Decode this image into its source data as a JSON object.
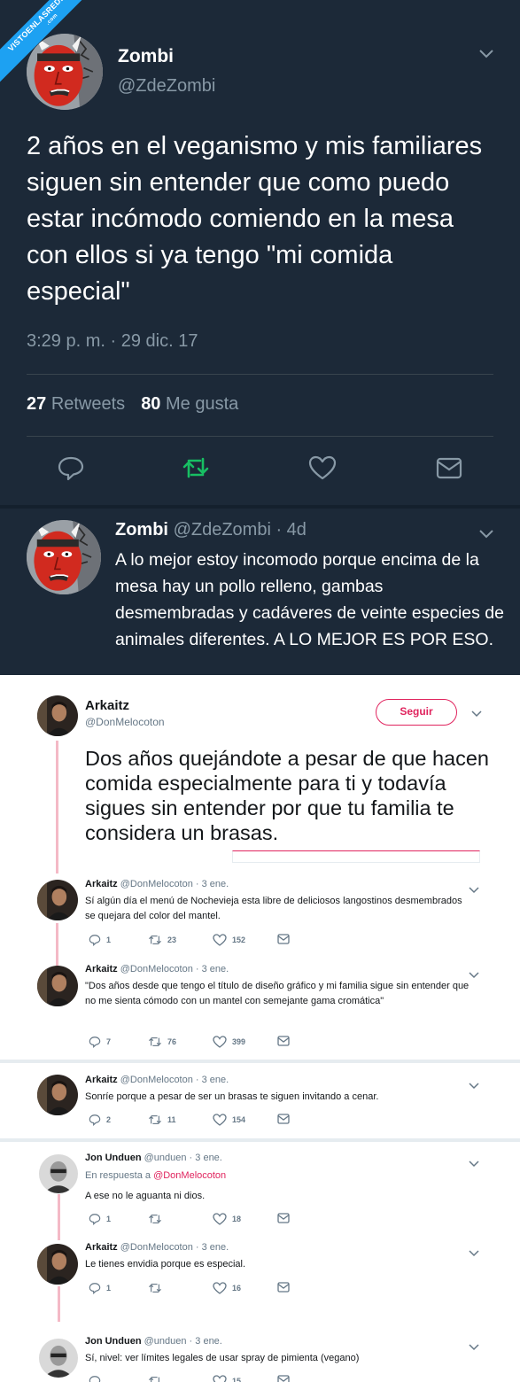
{
  "watermark": {
    "text": "VISTOENLASREDES",
    "sub": ".com"
  },
  "main_tweet": {
    "name": "Zombi",
    "handle": "@ZdeZombi",
    "text": "2 años en el veganismo y mis familiares siguen sin entender que como puedo estar incómodo comiendo en la mesa con ellos si ya tengo \"mi comida especial\"",
    "time": "3:29 p. m. · 29 dic. 17",
    "retweets_count": "27",
    "retweets_label": "Retweets",
    "likes_count": "80",
    "likes_label": "Me gusta",
    "accent_color": "#17bf63"
  },
  "thread_tweet": {
    "name": "Zombi",
    "handle_time": "@ZdeZombi · 4d",
    "text": "A lo mejor estoy incomodo porque encima de la mesa hay un pollo relleno, gambas desmembradas y cadáveres de veinte especies de animales diferentes. A LO MEJOR ES POR ESO."
  },
  "quoted_tweet": {
    "name": "Arkaitz",
    "handle": "@DonMelocoton",
    "follow_label": "Seguir",
    "text": "Dos años quejándote a pesar de que hacen comida especialmente para ti y todavía sigues sin entender por que tu familia te considera un brasas.",
    "accent_color": "#e0245e"
  },
  "replies": [
    {
      "name": "Arkaitz",
      "meta": "@DonMelocoton · 3 ene.",
      "text": "Sí algún día el menú de Nochevieja esta libre de deliciosos langostinos desmembrados se quejara del color del mantel.",
      "replies": "1",
      "retweets": "23",
      "likes": "152"
    },
    {
      "name": "Arkaitz",
      "meta": "@DonMelocoton · 3 ene.",
      "text": "\"Dos años desde que tengo el título de diseño gráfico y mi familia sigue sin entender que no me sienta cómodo con un mantel con semejante gama cromática\"",
      "replies": "7",
      "retweets": "76",
      "likes": "399"
    },
    {
      "name": "Arkaitz",
      "meta": "@DonMelocoton · 3 ene.",
      "text": "Sonríe porque a pesar de ser un brasas te siguen invitando a cenar.",
      "replies": "2",
      "retweets": "11",
      "likes": "154"
    },
    {
      "name": "Jon Unduen",
      "meta": "@unduen · 3 ene.",
      "reply_to_label": "En respuesta a",
      "reply_to_handle": "@DonMelocoton",
      "text": "A ese no le aguanta ni dios.",
      "replies": "1",
      "retweets": "",
      "likes": "18"
    },
    {
      "name": "Arkaitz",
      "meta": "@DonMelocoton · 3 ene.",
      "text": "Le tienes envidia porque es especial.",
      "replies": "1",
      "retweets": "",
      "likes": "16"
    },
    {
      "name": "Jon Unduen",
      "meta": "@unduen · 3 ene.",
      "text": "Sí, nivel: ver límites legales de usar spray de pimienta (vegano)",
      "replies": "",
      "retweets": "",
      "likes": "15"
    }
  ]
}
